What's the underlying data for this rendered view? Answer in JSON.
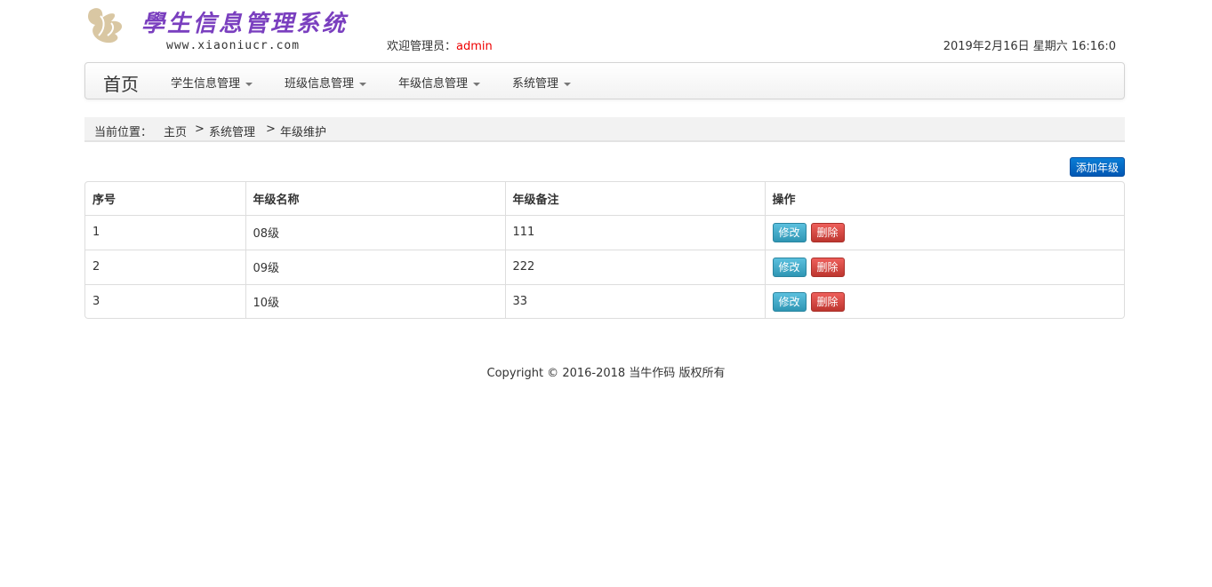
{
  "header": {
    "logo_title": "學生信息管理系统",
    "logo_url": "www.xiaoniucr.com",
    "welcome_prefix": "欢迎管理员：",
    "admin_name": "admin",
    "datetime": "2019年2月16日 星期六 16:16:0"
  },
  "navbar": {
    "brand": "首页",
    "items": [
      {
        "label": "学生信息管理"
      },
      {
        "label": "班级信息管理"
      },
      {
        "label": "年级信息管理"
      },
      {
        "label": "系统管理"
      }
    ]
  },
  "breadcrumb": {
    "prefix": "当前位置：",
    "items": [
      "主页",
      "系统管理",
      "年级维护"
    ],
    "separator": ">"
  },
  "actions": {
    "add_label": "添加年级"
  },
  "table": {
    "headers": [
      "序号",
      "年级名称",
      "年级备注",
      "操作"
    ],
    "rows": [
      {
        "id": "1",
        "name": "08级",
        "note": "111",
        "edit": "修改",
        "delete": "删除"
      },
      {
        "id": "2",
        "name": "09级",
        "note": "222",
        "edit": "修改",
        "delete": "删除"
      },
      {
        "id": "3",
        "name": "10级",
        "note": "33",
        "edit": "修改",
        "delete": "删除"
      }
    ]
  },
  "footer": {
    "copyright": "Copyright © 2016-2018 当牛作码 版权所有"
  },
  "colors": {
    "add_button": "#0a6fd0",
    "edit_button": "#49afcd",
    "delete_button": "#da4f49",
    "admin_name": "#ee0000",
    "logo_title": "#7a3fbf"
  }
}
